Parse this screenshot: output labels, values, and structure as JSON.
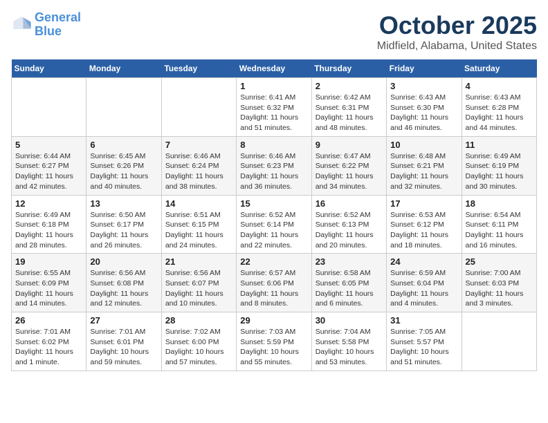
{
  "logo": {
    "line1": "General",
    "line2": "Blue"
  },
  "title": "October 2025",
  "subtitle": "Midfield, Alabama, United States",
  "days_of_week": [
    "Sunday",
    "Monday",
    "Tuesday",
    "Wednesday",
    "Thursday",
    "Friday",
    "Saturday"
  ],
  "weeks": [
    [
      {
        "day": "",
        "info": ""
      },
      {
        "day": "",
        "info": ""
      },
      {
        "day": "",
        "info": ""
      },
      {
        "day": "1",
        "info": "Sunrise: 6:41 AM\nSunset: 6:32 PM\nDaylight: 11 hours\nand 51 minutes."
      },
      {
        "day": "2",
        "info": "Sunrise: 6:42 AM\nSunset: 6:31 PM\nDaylight: 11 hours\nand 48 minutes."
      },
      {
        "day": "3",
        "info": "Sunrise: 6:43 AM\nSunset: 6:30 PM\nDaylight: 11 hours\nand 46 minutes."
      },
      {
        "day": "4",
        "info": "Sunrise: 6:43 AM\nSunset: 6:28 PM\nDaylight: 11 hours\nand 44 minutes."
      }
    ],
    [
      {
        "day": "5",
        "info": "Sunrise: 6:44 AM\nSunset: 6:27 PM\nDaylight: 11 hours\nand 42 minutes."
      },
      {
        "day": "6",
        "info": "Sunrise: 6:45 AM\nSunset: 6:26 PM\nDaylight: 11 hours\nand 40 minutes."
      },
      {
        "day": "7",
        "info": "Sunrise: 6:46 AM\nSunset: 6:24 PM\nDaylight: 11 hours\nand 38 minutes."
      },
      {
        "day": "8",
        "info": "Sunrise: 6:46 AM\nSunset: 6:23 PM\nDaylight: 11 hours\nand 36 minutes."
      },
      {
        "day": "9",
        "info": "Sunrise: 6:47 AM\nSunset: 6:22 PM\nDaylight: 11 hours\nand 34 minutes."
      },
      {
        "day": "10",
        "info": "Sunrise: 6:48 AM\nSunset: 6:21 PM\nDaylight: 11 hours\nand 32 minutes."
      },
      {
        "day": "11",
        "info": "Sunrise: 6:49 AM\nSunset: 6:19 PM\nDaylight: 11 hours\nand 30 minutes."
      }
    ],
    [
      {
        "day": "12",
        "info": "Sunrise: 6:49 AM\nSunset: 6:18 PM\nDaylight: 11 hours\nand 28 minutes."
      },
      {
        "day": "13",
        "info": "Sunrise: 6:50 AM\nSunset: 6:17 PM\nDaylight: 11 hours\nand 26 minutes."
      },
      {
        "day": "14",
        "info": "Sunrise: 6:51 AM\nSunset: 6:15 PM\nDaylight: 11 hours\nand 24 minutes."
      },
      {
        "day": "15",
        "info": "Sunrise: 6:52 AM\nSunset: 6:14 PM\nDaylight: 11 hours\nand 22 minutes."
      },
      {
        "day": "16",
        "info": "Sunrise: 6:52 AM\nSunset: 6:13 PM\nDaylight: 11 hours\nand 20 minutes."
      },
      {
        "day": "17",
        "info": "Sunrise: 6:53 AM\nSunset: 6:12 PM\nDaylight: 11 hours\nand 18 minutes."
      },
      {
        "day": "18",
        "info": "Sunrise: 6:54 AM\nSunset: 6:11 PM\nDaylight: 11 hours\nand 16 minutes."
      }
    ],
    [
      {
        "day": "19",
        "info": "Sunrise: 6:55 AM\nSunset: 6:09 PM\nDaylight: 11 hours\nand 14 minutes."
      },
      {
        "day": "20",
        "info": "Sunrise: 6:56 AM\nSunset: 6:08 PM\nDaylight: 11 hours\nand 12 minutes."
      },
      {
        "day": "21",
        "info": "Sunrise: 6:56 AM\nSunset: 6:07 PM\nDaylight: 11 hours\nand 10 minutes."
      },
      {
        "day": "22",
        "info": "Sunrise: 6:57 AM\nSunset: 6:06 PM\nDaylight: 11 hours\nand 8 minutes."
      },
      {
        "day": "23",
        "info": "Sunrise: 6:58 AM\nSunset: 6:05 PM\nDaylight: 11 hours\nand 6 minutes."
      },
      {
        "day": "24",
        "info": "Sunrise: 6:59 AM\nSunset: 6:04 PM\nDaylight: 11 hours\nand 4 minutes."
      },
      {
        "day": "25",
        "info": "Sunrise: 7:00 AM\nSunset: 6:03 PM\nDaylight: 11 hours\nand 3 minutes."
      }
    ],
    [
      {
        "day": "26",
        "info": "Sunrise: 7:01 AM\nSunset: 6:02 PM\nDaylight: 11 hours\nand 1 minute."
      },
      {
        "day": "27",
        "info": "Sunrise: 7:01 AM\nSunset: 6:01 PM\nDaylight: 10 hours\nand 59 minutes."
      },
      {
        "day": "28",
        "info": "Sunrise: 7:02 AM\nSunset: 6:00 PM\nDaylight: 10 hours\nand 57 minutes."
      },
      {
        "day": "29",
        "info": "Sunrise: 7:03 AM\nSunset: 5:59 PM\nDaylight: 10 hours\nand 55 minutes."
      },
      {
        "day": "30",
        "info": "Sunrise: 7:04 AM\nSunset: 5:58 PM\nDaylight: 10 hours\nand 53 minutes."
      },
      {
        "day": "31",
        "info": "Sunrise: 7:05 AM\nSunset: 5:57 PM\nDaylight: 10 hours\nand 51 minutes."
      },
      {
        "day": "",
        "info": ""
      }
    ]
  ]
}
